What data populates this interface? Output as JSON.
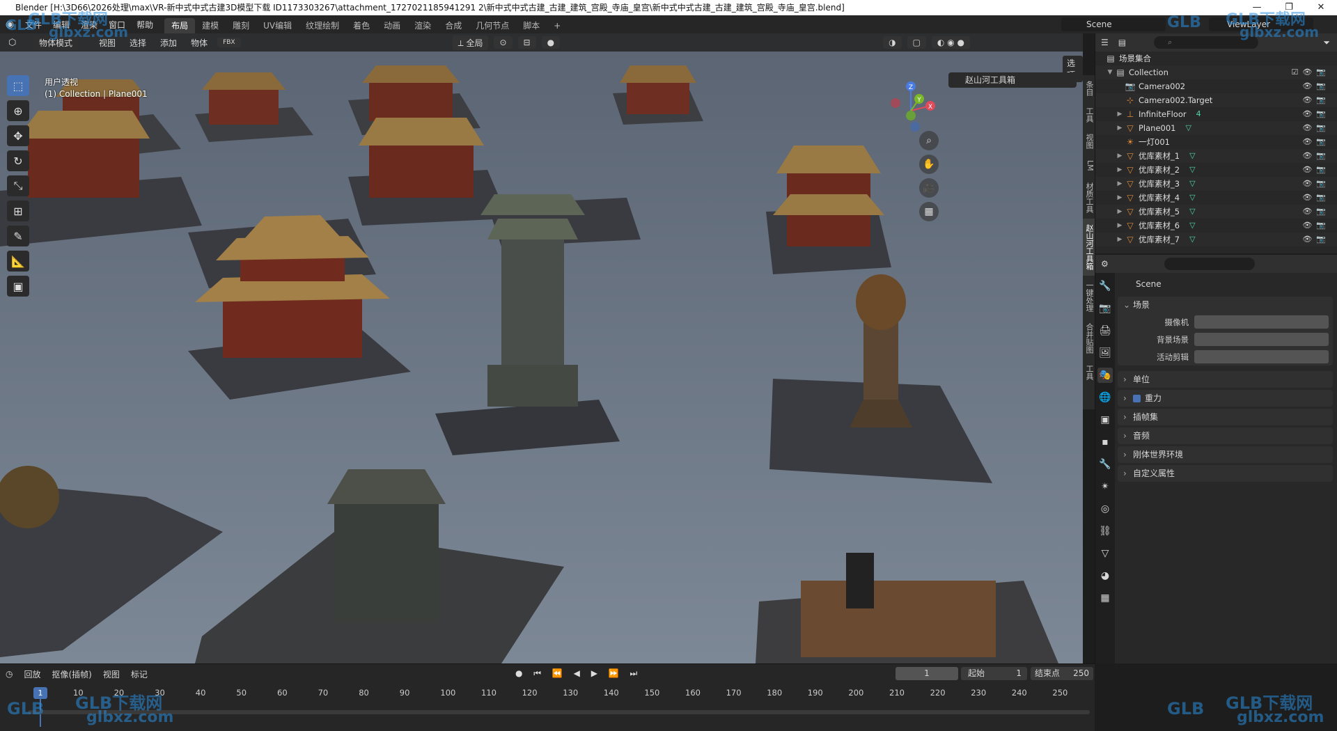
{
  "window": {
    "title": "Blender [H:\\3D66\\2026处理\\max\\VR-新中式中式古建3D模型下载 ID1173303267\\attachment_1727021185941291 2\\新中式中式古建_古建_建筑_宫殿_寺庙_皇宫\\新中式中式古建_古建_建筑_宫殿_寺庙_皇宫.blend]",
    "controls": [
      "—",
      "❐",
      "✕"
    ]
  },
  "menu": [
    "文件",
    "编辑",
    "渲染",
    "窗口",
    "帮助"
  ],
  "workspace_tabs": [
    "布局",
    "建模",
    "雕刻",
    "UV编辑",
    "纹理绘制",
    "着色",
    "动画",
    "渲染",
    "合成",
    "几何节点",
    "脚本",
    "+"
  ],
  "active_tab": "布局",
  "scene_name": "Scene",
  "view_layer": "ViewLayer",
  "viewport": {
    "mode": "物体模式",
    "menus": [
      "视图",
      "选择",
      "添加",
      "物体"
    ],
    "transform_orientation": "全局",
    "options_label": "选项",
    "info_line1": "用户透视",
    "info_line2": "(1) Collection | Plane001",
    "npanel_label": "赵山河工具箱",
    "side_tabs": [
      "条目",
      "工具",
      "视图",
      "LM",
      "材质工具",
      "赵山河工具箱",
      "一键处理",
      "合并贴图",
      "工具"
    ],
    "gizmo_axes": [
      "Z",
      "Y",
      "X"
    ]
  },
  "outliner": {
    "root": "场景集合",
    "collection": "Collection",
    "items": [
      {
        "name": "Camera002",
        "icon": "camera-icon",
        "expand": false,
        "mod": ""
      },
      {
        "name": "Camera002.Target",
        "icon": "empty-icon",
        "expand": false,
        "mod": ""
      },
      {
        "name": "InfiniteFloor",
        "icon": "object-icon",
        "expand": true,
        "mod": "4"
      },
      {
        "name": "Plane001",
        "icon": "mesh-icon",
        "expand": true,
        "mod": "▽"
      },
      {
        "name": "一灯001",
        "icon": "light-icon",
        "expand": false,
        "mod": ""
      },
      {
        "name": "优库素材_1",
        "icon": "mesh-icon",
        "expand": true,
        "mod": "▽"
      },
      {
        "name": "优库素材_2",
        "icon": "mesh-icon",
        "expand": true,
        "mod": "▽"
      },
      {
        "name": "优库素材_3",
        "icon": "mesh-icon",
        "expand": true,
        "mod": "▽"
      },
      {
        "name": "优库素材_4",
        "icon": "mesh-icon",
        "expand": true,
        "mod": "▽"
      },
      {
        "name": "优库素材_5",
        "icon": "mesh-icon",
        "expand": true,
        "mod": "▽"
      },
      {
        "name": "优库素材_6",
        "icon": "mesh-icon",
        "expand": true,
        "mod": "▽"
      },
      {
        "name": "优库素材_7",
        "icon": "mesh-icon",
        "expand": true,
        "mod": "▽"
      }
    ]
  },
  "properties": {
    "title": "Scene",
    "scene_panel": "场景",
    "fields": [
      "摄像机",
      "背景场景",
      "活动剪辑"
    ],
    "sections": [
      "单位",
      "重力",
      "插帧集",
      "音频",
      "刚体世界环境",
      "自定义属性"
    ]
  },
  "timeline": {
    "menus": [
      "回放",
      "抠像(插帧)",
      "视图",
      "标记"
    ],
    "current_frame": "1",
    "start_label": "起始",
    "start": "1",
    "end_label": "结束点",
    "end": "250",
    "ruler": [
      "1",
      "10",
      "20",
      "30",
      "40",
      "50",
      "60",
      "70",
      "80",
      "90",
      "100",
      "110",
      "120",
      "130",
      "140",
      "150",
      "160",
      "170",
      "180",
      "190",
      "200",
      "210",
      "220",
      "230",
      "240",
      "250"
    ]
  },
  "watermark": {
    "brand": "GLB下载网",
    "site": "glbxz.com",
    "logo": "GLB"
  }
}
